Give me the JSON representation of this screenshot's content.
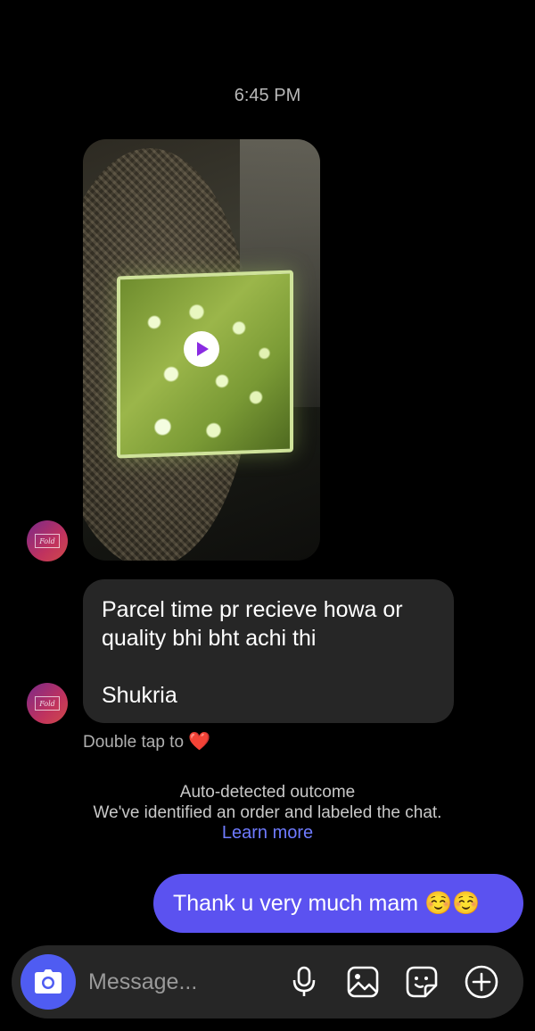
{
  "chat": {
    "timestamp": "6:45 PM",
    "received_text": {
      "line1": "Parcel time pr recieve howa or",
      "line2": "quality bhi bht achi thi",
      "line3": "Shukria"
    },
    "double_tap": "Double tap to",
    "double_tap_emoji": "❤️",
    "auto_detected": {
      "title": "Auto-detected outcome",
      "body": "We've identified an order and labeled the chat.",
      "link": "Learn more"
    },
    "sent_text": "Thank u very much mam ☺️☺️"
  },
  "composer": {
    "placeholder": "Message..."
  },
  "icons": [
    "play-icon",
    "camera-icon",
    "microphone-icon",
    "gallery-icon",
    "sticker-icon",
    "plus-icon"
  ],
  "colors": {
    "background": "#000000",
    "received_bubble": "#262626",
    "sent_bubble": "#5b52f0",
    "accent_link": "#6f7bff",
    "camera_button": "#4f5cf2"
  }
}
